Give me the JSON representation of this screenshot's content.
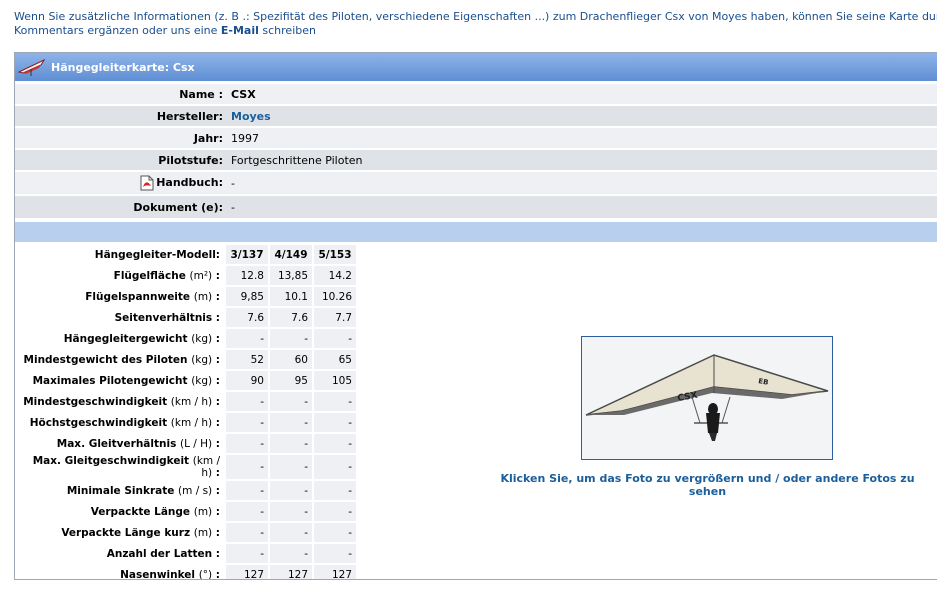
{
  "intro": {
    "text1": "Wenn Sie zusätzliche Informationen (z. B .: Spezifität des Piloten, verschiedene Eigenschaften ...) zum Drachenflieger Csx von Moyes haben, können Sie seine Karte durch",
    "text2": "Kommentars ergänzen oder uns eine ",
    "email_link": "E-Mail",
    "text3": " schreiben"
  },
  "card": {
    "title": "Hängegleiterkarte: Csx",
    "info": [
      {
        "label": "Name :",
        "value": "CSX",
        "bold": true
      },
      {
        "label": "Hersteller:",
        "value": "Moyes",
        "link": true
      },
      {
        "label": "Jahr:",
        "value": "1997"
      },
      {
        "label": "Pilotstufe:",
        "value": "Fortgeschrittene Piloten"
      },
      {
        "label": "Handbuch:",
        "value": "-"
      },
      {
        "label": "Dokument (e):",
        "value": "-"
      }
    ],
    "handbuch_icon": "pdf-icon",
    "tech": {
      "header_label": "Hängegleiter-Modell:",
      "models": [
        "3/137",
        "4/149",
        "5/153"
      ],
      "rows": [
        {
          "label": "Flügelfläche",
          "unit": "(m²)",
          "values": [
            "12.8",
            "13,85",
            "14.2"
          ]
        },
        {
          "label": "Flügelspannweite",
          "unit": "(m)",
          "values": [
            "9,85",
            "10.1",
            "10.26"
          ]
        },
        {
          "label": "Seitenverhältnis",
          "unit": "",
          "values": [
            "7.6",
            "7.6",
            "7.7"
          ]
        },
        {
          "label": "Hängegleitergewicht",
          "unit": "(kg)",
          "values": [
            "-",
            "-",
            "-"
          ]
        },
        {
          "label": "Mindestgewicht des Piloten",
          "unit": "(kg)",
          "values": [
            "52",
            "60",
            "65"
          ]
        },
        {
          "label": "Maximales Pilotengewicht",
          "unit": "(kg)",
          "values": [
            "90",
            "95",
            "105"
          ]
        },
        {
          "label": "Mindestgeschwindigkeit",
          "unit": "(km / h)",
          "values": [
            "-",
            "-",
            "-"
          ]
        },
        {
          "label": "Höchstgeschwindigkeit",
          "unit": "(km / h)",
          "values": [
            "-",
            "-",
            "-"
          ]
        },
        {
          "label": "Max. Gleitverhältnis",
          "unit": "(L / H)",
          "values": [
            "-",
            "-",
            "-"
          ]
        },
        {
          "label": "Max. Gleitgeschwindigkeit",
          "unit": "(km / h)",
          "values": [
            "-",
            "-",
            "-"
          ]
        },
        {
          "label": "Minimale Sinkrate",
          "unit": "(m / s)",
          "values": [
            "-",
            "-",
            "-"
          ]
        },
        {
          "label": "Verpackte Länge",
          "unit": "(m)",
          "values": [
            "-",
            "-",
            "-"
          ]
        },
        {
          "label": "Verpackte Länge kurz",
          "unit": "(m)",
          "values": [
            "-",
            "-",
            "-"
          ]
        },
        {
          "label": "Anzahl der Latten",
          "unit": "",
          "values": [
            "-",
            "-",
            "-"
          ]
        },
        {
          "label": "Nasenwinkel",
          "unit": "(°)",
          "values": [
            "127",
            "127",
            "127"
          ]
        }
      ]
    },
    "photo_caption": "Klicken Sie, um das Foto zu vergrößern und / oder andere Fotos zu sehen"
  },
  "colors": {
    "header_top": "#8fb4ea",
    "header_bottom": "#5f8ed3",
    "link": "#1a5e9c",
    "row_light": "#eef0f3",
    "row_dark": "#dfe3e8"
  }
}
